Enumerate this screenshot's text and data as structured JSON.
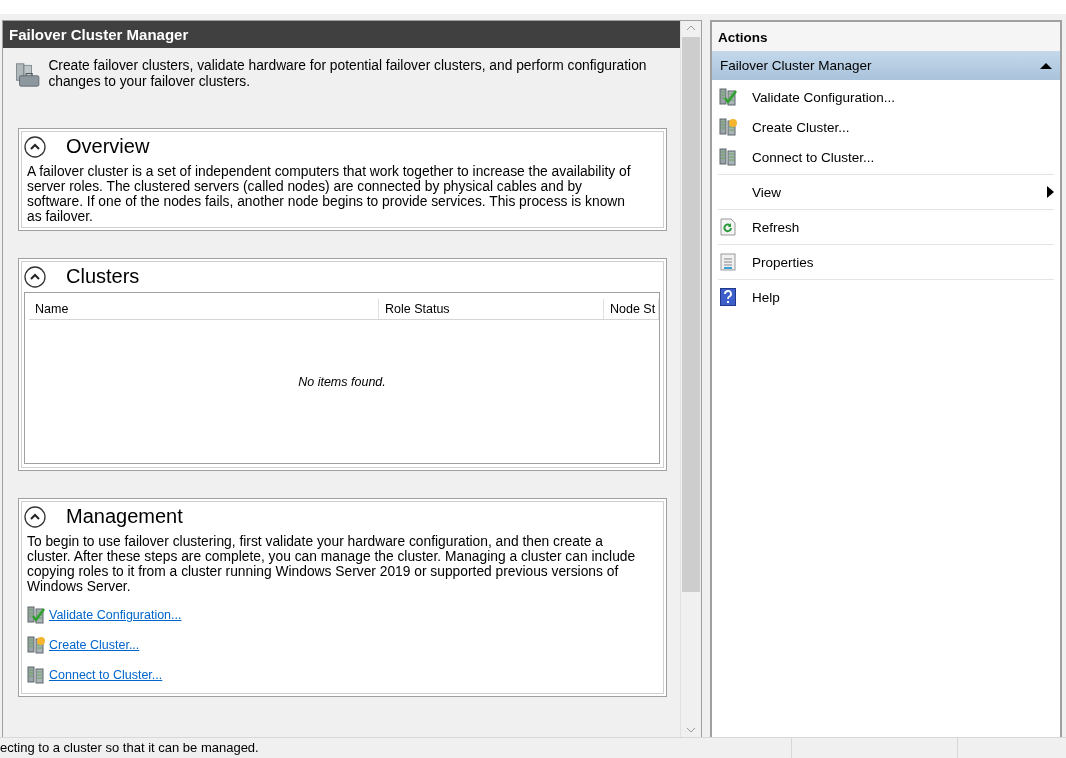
{
  "main_pane": {
    "title": "Failover Cluster Manager",
    "intro": "Create failover clusters, validate hardware for potential failover clusters, and perform configuration changes to your failover clusters.",
    "sections": [
      {
        "kind": "text",
        "title": "Overview",
        "expanded": true,
        "body": "A failover cluster is a set of independent computers that work together to increase the availability of server roles. The clustered servers (called nodes) are connected by physical cables and by software. If one of the nodes fails, another node begins to provide services. This process is known as failover."
      },
      {
        "kind": "table",
        "title": "Clusters",
        "expanded": true,
        "columns": [
          "Name",
          "Role Status",
          "Node St"
        ],
        "empty_text": "No items found."
      },
      {
        "kind": "links",
        "title": "Management",
        "expanded": true,
        "body": "To begin to use failover clustering, first validate your hardware configuration, and then create a cluster. After these steps are complete, you can manage the cluster. Managing a cluster can include copying roles to it from a cluster running Windows Server 2019 or supported previous versions of Windows Server.",
        "links": [
          {
            "kind": "validate",
            "label": "Validate Configuration..."
          },
          {
            "kind": "create",
            "label": "Create Cluster..."
          },
          {
            "kind": "connect",
            "label": "Connect to Cluster..."
          }
        ]
      }
    ]
  },
  "actions_pane": {
    "title": "Actions",
    "group_title": "Failover Cluster Manager",
    "expanded": true,
    "groups": [
      [
        {
          "kind": "validate",
          "label": "Validate Configuration..."
        },
        {
          "kind": "create",
          "label": "Create Cluster..."
        },
        {
          "kind": "connect",
          "label": "Connect to Cluster..."
        }
      ],
      [
        {
          "kind": "view",
          "label": "View",
          "submenu": true
        }
      ],
      [
        {
          "kind": "refresh",
          "label": "Refresh"
        }
      ],
      [
        {
          "kind": "properties",
          "label": "Properties"
        }
      ],
      [
        {
          "kind": "help",
          "label": "Help"
        }
      ]
    ]
  },
  "status_bar": {
    "text": "ecting to a cluster so that it can be managed."
  }
}
